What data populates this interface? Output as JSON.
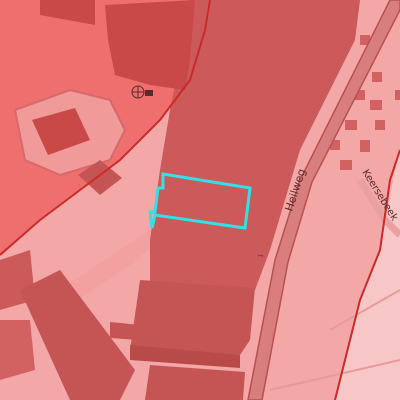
{
  "map": {
    "streets": {
      "main_road": "Heilweg",
      "side_street": "Keersebeek"
    },
    "selection": {
      "outline_color": "#33e0e6",
      "label": ""
    },
    "colors": {
      "light_zone": "#f6b4b4",
      "zone_fill": "#ef7878",
      "outside_zone": "#f7c6c6",
      "building": "#cc5a5a",
      "building_dark": "#b84a4a",
      "zone_border": "#cc2a2a",
      "road": "#d87e7e",
      "road_edge": "#b85050"
    }
  }
}
